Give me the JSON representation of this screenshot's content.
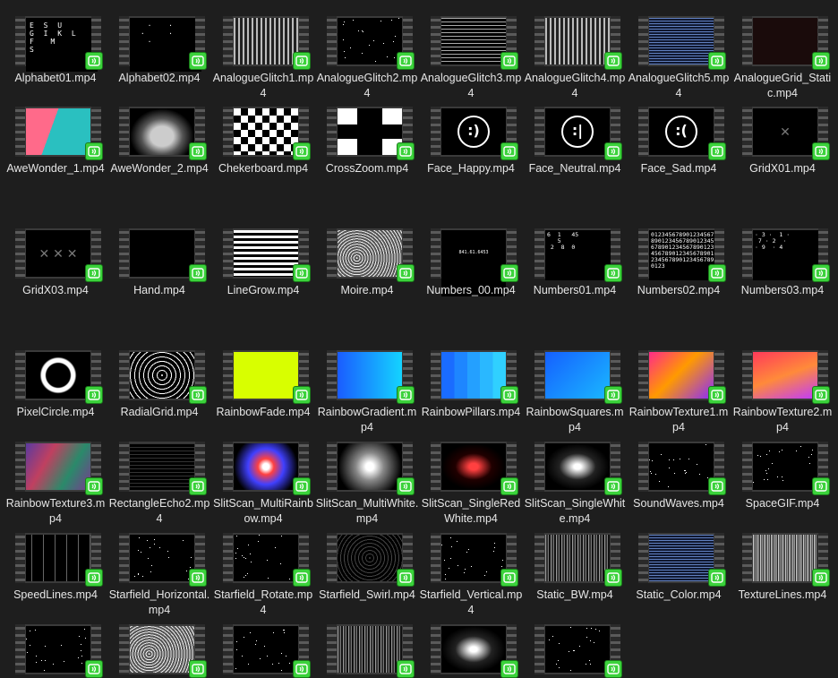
{
  "files": [
    {
      "name": "Alphabet01.mp4",
      "preview": "p-text",
      "text": "E S U\nG I K L\nF  M\nS"
    },
    {
      "name": "Alphabet02.mp4",
      "preview": "p-text",
      "text": "  ·  ·\n ·   ·\n  ·"
    },
    {
      "name": "AnalogueGlitch1.mp4",
      "preview": "p-lines"
    },
    {
      "name": "AnalogueGlitch2.mp4",
      "preview": "p-stars"
    },
    {
      "name": "AnalogueGlitch3.mp4",
      "preview": "p-lines2"
    },
    {
      "name": "AnalogueGlitch4.mp4",
      "preview": "p-lines"
    },
    {
      "name": "AnalogueGlitch5.mp4",
      "preview": "p-static2"
    },
    {
      "name": "AnalogueGrid_Static.mp4",
      "preview": "p-darkred"
    },
    {
      "name": "AweWonder_1.mp4",
      "preview": "p-pink"
    },
    {
      "name": "AweWonder_2.mp4",
      "preview": "p-ghost"
    },
    {
      "name": "Chekerboard.mp4",
      "preview": "p-check"
    },
    {
      "name": "CrossZoom.mp4",
      "preview": "p-crosszoom"
    },
    {
      "name": "Face_Happy.mp4",
      "preview": "p-face",
      "text": ":)"
    },
    {
      "name": "Face_Neutral.mp4",
      "preview": "p-face",
      "text": ":|"
    },
    {
      "name": "Face_Sad.mp4",
      "preview": "p-face",
      "text": ":("
    },
    {
      "name": "GridX01.mp4",
      "preview": "p-cross",
      "text": "✕"
    },
    {
      "name": "GridX03.mp4",
      "preview": "p-cross",
      "text": "✕ ✕ ✕"
    },
    {
      "name": "Hand.mp4",
      "preview": "p-hand"
    },
    {
      "name": "LineGrow.mp4",
      "preview": "p-hlines"
    },
    {
      "name": "Moire.mp4",
      "preview": "p-moire"
    },
    {
      "name": "Numbers_00.mp4",
      "preview": "p-nums-s",
      "text": "841.61.6453"
    },
    {
      "name": "Numbers01.mp4",
      "preview": "p-nums",
      "text": "6  1   45\n   5\n 2  8  0"
    },
    {
      "name": "Numbers02.mp4",
      "preview": "p-nums",
      "text": "0123456789012345678901234567890123456789012345678901234567890123456789012345678901234567890123"
    },
    {
      "name": "Numbers03.mp4",
      "preview": "p-nums",
      "text": "· 3 ·  1 ·\n 7 · 2  ·\n· 9  · 4"
    },
    {
      "name": "PixelCircle.mp4",
      "preview": "p-pixel"
    },
    {
      "name": "RadialGrid.mp4",
      "preview": "p-radial"
    },
    {
      "name": "RainbowFade.mp4",
      "preview": "p-yellow"
    },
    {
      "name": "RainbowGradient.mp4",
      "preview": "p-blue"
    },
    {
      "name": "RainbowPillars.mp4",
      "preview": "p-blue2"
    },
    {
      "name": "RainbowSquares.mp4",
      "preview": "p-blue3"
    },
    {
      "name": "RainbowTexture1.mp4",
      "preview": "p-rt1"
    },
    {
      "name": "RainbowTexture2.mp4",
      "preview": "p-rt2"
    },
    {
      "name": "RainbowTexture3.mp4",
      "preview": "p-rt3"
    },
    {
      "name": "RectangleEcho2.mp4",
      "preview": "p-rect"
    },
    {
      "name": "SlitScan_MultiRainbow.mp4",
      "preview": "p-burst"
    },
    {
      "name": "SlitScan_MultiWhite.mp4",
      "preview": "p-burstw"
    },
    {
      "name": "SlitScan_SingleRedWhite.mp4",
      "preview": "p-red"
    },
    {
      "name": "SlitScan_SingleWhite.mp4",
      "preview": "p-white"
    },
    {
      "name": "SoundWaves.mp4",
      "preview": "p-sound"
    },
    {
      "name": "SpaceGIF.mp4",
      "preview": "p-stars"
    },
    {
      "name": "SpeedLines.mp4",
      "preview": "p-speed"
    },
    {
      "name": "Starfield_Horizontal.mp4",
      "preview": "p-stars"
    },
    {
      "name": "Starfield_Rotate.mp4",
      "preview": "p-stars"
    },
    {
      "name": "Starfield_Swirl.mp4",
      "preview": "p-swirl"
    },
    {
      "name": "Starfield_Vertical.mp4",
      "preview": "p-stars"
    },
    {
      "name": "Static_BW.mp4",
      "preview": "p-static"
    },
    {
      "name": "Static_Color.mp4",
      "preview": "p-static2"
    },
    {
      "name": "TextureLines.mp4",
      "preview": "p-tex"
    },
    {
      "name": "",
      "preview": "p-stars"
    },
    {
      "name": "",
      "preview": "p-moire"
    },
    {
      "name": "",
      "preview": "p-stars"
    },
    {
      "name": "",
      "preview": "p-static"
    },
    {
      "name": "",
      "preview": "p-white"
    },
    {
      "name": "",
      "preview": "p-stars"
    }
  ],
  "badge_icon": "play-media-icon",
  "colors": {
    "background": "#1e1e1e",
    "badge": "#3bd23b",
    "label": "#e6e6e6"
  }
}
